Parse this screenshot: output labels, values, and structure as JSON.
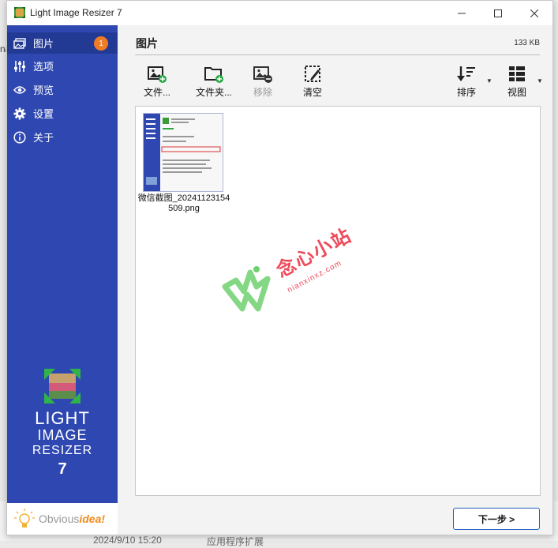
{
  "window": {
    "title": "Light Image Resizer 7"
  },
  "sidebar": {
    "items": [
      {
        "label": "图片",
        "icon": "images-icon",
        "badge": "1"
      },
      {
        "label": "选项",
        "icon": "sliders-icon"
      },
      {
        "label": "预览",
        "icon": "eye-icon"
      },
      {
        "label": "设置",
        "icon": "gear-icon"
      },
      {
        "label": "关于",
        "icon": "info-icon"
      }
    ],
    "logo": {
      "line1": "LIGHT",
      "line2": "IMAGE",
      "line3": "RESIZER",
      "line4": "7"
    },
    "footer_brand": {
      "part1": "Obvious",
      "part2": "idea!"
    }
  },
  "header": {
    "title": "图片",
    "size": "133 KB"
  },
  "toolbar": {
    "add_files": "文件...",
    "add_folder": "文件夹...",
    "remove": "移除",
    "clear": "清空",
    "sort": "排序",
    "view": "视图"
  },
  "files": [
    {
      "name": "微信截图_20241123154509.png"
    }
  ],
  "watermark": {
    "text": "念心小站",
    "sub": "nianxinxz.com"
  },
  "footer": {
    "next_label": "下一步 >"
  },
  "background": {
    "date": "2024/9/10 15:20",
    "app": "应用程序扩展",
    "left_fragment": "na"
  },
  "colors": {
    "sidebar": "#2f48b1",
    "accent": "#1f5fbf",
    "badge": "#f07b25"
  }
}
